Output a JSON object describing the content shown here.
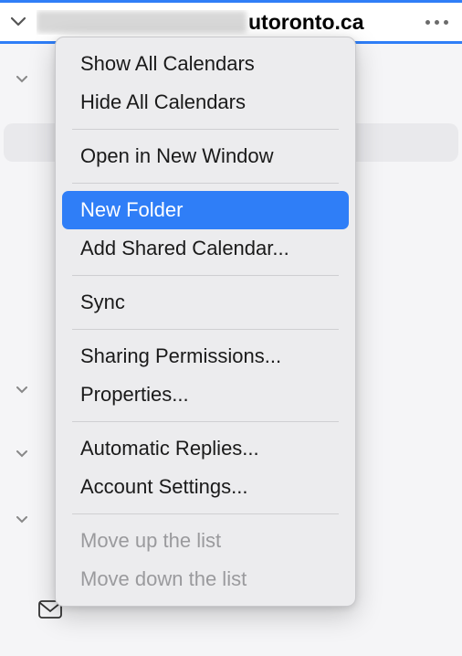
{
  "header": {
    "account_domain_visible": "utoronto.ca"
  },
  "menu": {
    "show_all": "Show All Calendars",
    "hide_all": "Hide All Calendars",
    "open_new_window": "Open in New Window",
    "new_folder": "New Folder",
    "add_shared": "Add Shared Calendar...",
    "sync": "Sync",
    "sharing_permissions": "Sharing Permissions...",
    "properties": "Properties...",
    "automatic_replies": "Automatic Replies...",
    "account_settings": "Account Settings...",
    "move_up": "Move up the list",
    "move_down": "Move down the list"
  }
}
